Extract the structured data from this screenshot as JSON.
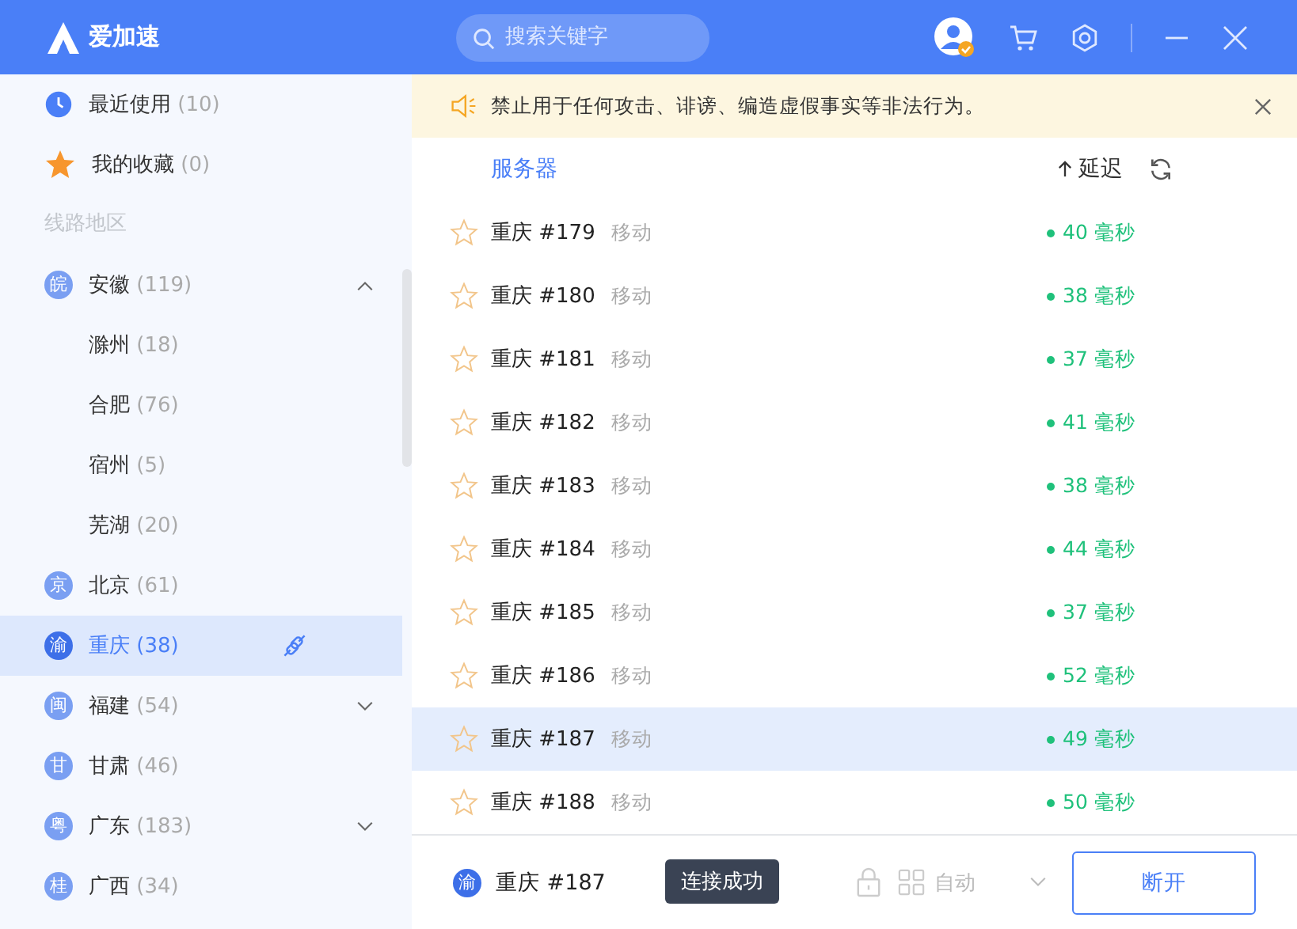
{
  "app": {
    "name": "爱加速"
  },
  "search": {
    "placeholder": "搜索关键字"
  },
  "sidebar": {
    "pinned": [
      {
        "kind": "recent",
        "label": "最近使用",
        "count": "(10)"
      },
      {
        "kind": "favorites",
        "label": "我的收藏",
        "count": "(0)"
      }
    ],
    "section_label": "线路地区",
    "regions": [
      {
        "badge": "皖",
        "name": "安徽",
        "count": "(119)",
        "kind": "group",
        "expanded": true,
        "selected": false,
        "children": [
          {
            "name": "滁州",
            "count": "(18)"
          },
          {
            "name": "合肥",
            "count": "(76)"
          },
          {
            "name": "宿州",
            "count": "(5)"
          },
          {
            "name": "芜湖",
            "count": "(20)"
          }
        ]
      },
      {
        "badge": "京",
        "name": "北京",
        "count": "(61)",
        "kind": "single",
        "selected": false
      },
      {
        "badge": "渝",
        "name": "重庆",
        "count": "(38)",
        "kind": "single",
        "selected": true
      },
      {
        "badge": "闽",
        "name": "福建",
        "count": "(54)",
        "kind": "group",
        "expanded": false,
        "selected": false
      },
      {
        "badge": "甘",
        "name": "甘肃",
        "count": "(46)",
        "kind": "single",
        "selected": false
      },
      {
        "badge": "粤",
        "name": "广东",
        "count": "(183)",
        "kind": "group",
        "expanded": false,
        "selected": false
      },
      {
        "badge": "桂",
        "name": "广西",
        "count": "(34)",
        "kind": "single",
        "selected": false
      }
    ]
  },
  "notice": {
    "text": "禁止用于任何攻击、诽谤、编造虚假事实等非法行为。"
  },
  "table": {
    "columns": [
      {
        "label": "服务器"
      },
      {
        "label": "延迟"
      }
    ],
    "rows": [
      {
        "name": "重庆 #179",
        "carrier": "移动",
        "latency": "40 毫秒",
        "favorite": false,
        "selected": false
      },
      {
        "name": "重庆 #180",
        "carrier": "移动",
        "latency": "38 毫秒",
        "favorite": false,
        "selected": false
      },
      {
        "name": "重庆 #181",
        "carrier": "移动",
        "latency": "37 毫秒",
        "favorite": false,
        "selected": false
      },
      {
        "name": "重庆 #182",
        "carrier": "移动",
        "latency": "41 毫秒",
        "favorite": false,
        "selected": false
      },
      {
        "name": "重庆 #183",
        "carrier": "移动",
        "latency": "38 毫秒",
        "favorite": false,
        "selected": false
      },
      {
        "name": "重庆 #184",
        "carrier": "移动",
        "latency": "44 毫秒",
        "favorite": false,
        "selected": false
      },
      {
        "name": "重庆 #185",
        "carrier": "移动",
        "latency": "37 毫秒",
        "favorite": false,
        "selected": false
      },
      {
        "name": "重庆 #186",
        "carrier": "移动",
        "latency": "52 毫秒",
        "favorite": false,
        "selected": false
      },
      {
        "name": "重庆 #187",
        "carrier": "移动",
        "latency": "49 毫秒",
        "favorite": false,
        "selected": true
      },
      {
        "name": "重庆 #188",
        "carrier": "移动",
        "latency": "50 毫秒",
        "favorite": false,
        "selected": false
      }
    ]
  },
  "tooltip": {
    "text": "连接成功"
  },
  "footer": {
    "badge": "渝",
    "server": "重庆 #187",
    "mode": "自动",
    "button": "断开"
  }
}
